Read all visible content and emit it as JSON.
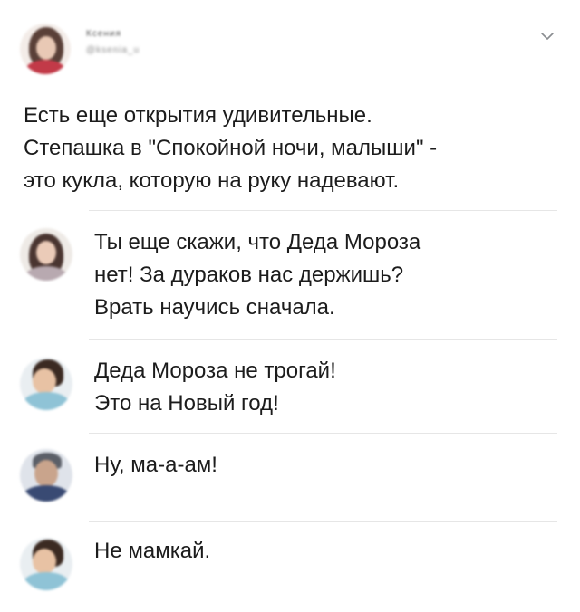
{
  "tweet": {
    "author_name": "Ксения",
    "author_handle": "@ksenia_u",
    "text_lines": [
      "Есть еще открытия удивительные.",
      "Степашка в \"Спокойной ночи, малыши\" -",
      "это кукла, которую на руку надевают."
    ]
  },
  "replies": [
    {
      "lines": [
        "Ты еще скажи, что Деда Мороза",
        "нет! За дураков нас держишь?",
        "Врать научись сначала."
      ]
    },
    {
      "lines": [
        "Деда Мороза не трогай!",
        "Это на Новый год!"
      ]
    },
    {
      "lines": [
        "Ну, ма-а-ам!"
      ]
    },
    {
      "lines": [
        "Не мамкай."
      ]
    }
  ],
  "icons": {
    "menu": "chevron-down-icon"
  },
  "colors": {
    "text": "#1c1c1c",
    "divider": "#e6e6e6",
    "chevron": "#8a8d91"
  }
}
